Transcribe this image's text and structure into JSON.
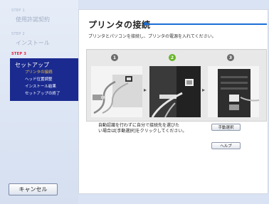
{
  "sidebar": {
    "step1": {
      "tag": "STEP 1",
      "title": "使用許諾契約"
    },
    "step2": {
      "tag": "STEP 2",
      "title": "インストール"
    },
    "step3": {
      "tag": "STEP 3",
      "title": "セットアップ",
      "items": [
        "プリンタの接続",
        "ヘッド位置調整",
        "インストール結果",
        "セットアップの終了"
      ]
    },
    "cancel_label": "キャンセル"
  },
  "page": {
    "title": "プリンタの接続",
    "instruction": "プリンタとパソコンを接続し、プリンタの電源を入れてください。",
    "steps": [
      "1",
      "2",
      "3"
    ],
    "auto_text_line1": "自動認識を行わずに自分で接続先を選びた",
    "auto_text_line2": "い場合は[手動選択]をクリックしてください。",
    "manual_button": "手動選択",
    "help_button": "ヘルプ"
  },
  "colors": {
    "sidebar_active": "#1a2a8f",
    "step_current": "#e0203a",
    "title_accent": "#1a6ed6",
    "step_badge_done": "#6b6b6b",
    "step_badge_current": "#6ab52a"
  }
}
